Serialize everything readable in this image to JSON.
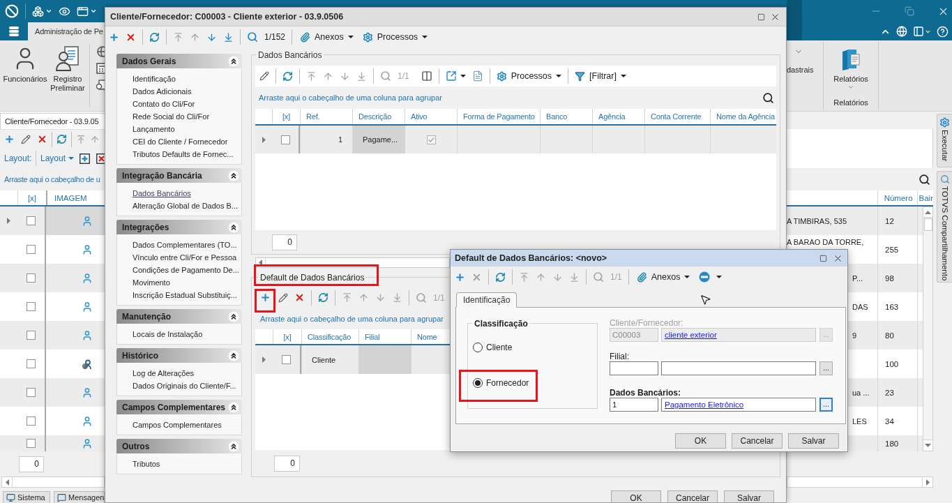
{
  "app": {
    "ribbon_tab": "Administração de Pe",
    "ribbon_buttons": [
      "Funcionários",
      "Registro Preliminar"
    ],
    "ribbon_cut_label": "dastrais",
    "reports_button": "Relatórios",
    "reports_group": "Relatórios",
    "list_window": {
      "title": "Cliente/Fornecedor - 03.9.05",
      "layout_label": "Layout:",
      "layout_menu": "Layout",
      "group_hint": "Arraste aqui o cabeçalho de u",
      "columns": [
        "[x]",
        "IMAGEM"
      ],
      "right_columns": [
        "Número",
        "Bair"
      ],
      "rows": [
        {
          "selected": true,
          "checked": false,
          "marked": false,
          "column_3": "A TIMBIRAS, 535",
          "number": "12"
        },
        {
          "selected": false,
          "checked": false,
          "marked": false,
          "column_3": "A BARAO DA TORRE,",
          "number": "255"
        },
        {
          "selected": false,
          "checked": false,
          "marked": false,
          "column_3": "P...",
          "number": "98"
        },
        {
          "selected": false,
          "checked": false,
          "marked": false,
          "column_3": "DAS",
          "number": "163"
        },
        {
          "selected": false,
          "checked": false,
          "marked": false,
          "column_3": "9",
          "number": "80"
        },
        {
          "selected": false,
          "checked": false,
          "marked": true,
          "number": "100"
        },
        {
          "selected": false,
          "checked": false,
          "marked": false,
          "column_3": "ua ...",
          "number": "23"
        },
        {
          "selected": false,
          "checked": false,
          "marked": false,
          "column_3": "LES",
          "number": "34"
        },
        {
          "selected": false,
          "checked": false,
          "marked": false,
          "number": "180"
        }
      ],
      "footer_count": "0"
    },
    "side_tabs": [
      "Executar",
      "TOTVS Compartilhamento"
    ],
    "taskbar": [
      "Sistema",
      "Mensagen"
    ]
  },
  "main_dialog": {
    "title": "Cliente/Fornecedor: C00003 - Cliente exterior - 03.9.0506",
    "toolbar": {
      "counter": {
        "text": "1/152",
        "disabled": false
      },
      "attachments": "Anexos",
      "processes": "Processos"
    },
    "nav_groups": [
      {
        "title": "Dados Gerais",
        "expanded": true,
        "items": [
          {
            "label": "Identificação",
            "selected": false
          },
          {
            "label": "Dados Adicionais",
            "selected": false
          },
          {
            "label": "Contato do Cli/For",
            "selected": false
          },
          {
            "label": "Rede Social do Cli/For",
            "selected": false
          },
          {
            "label": "Lançamento",
            "selected": false
          },
          {
            "label": "CEI do Cliente / Fornecedor",
            "selected": false
          },
          {
            "label": "Tributos Defaults de Fornec...",
            "selected": false
          }
        ]
      },
      {
        "title": "Integração Bancária",
        "expanded": true,
        "items": [
          {
            "label": "Dados Bancários",
            "selected": true
          },
          {
            "label": "Alteração Global de Dados B...",
            "selected": false
          }
        ]
      },
      {
        "title": "Integrações",
        "expanded": true,
        "items": [
          {
            "label": "Dados Complementares (TO...",
            "selected": false
          },
          {
            "label": "Vínculo entre Cli/For e Pessoa",
            "selected": false
          },
          {
            "label": "Condições de Pagamento De...",
            "selected": false
          },
          {
            "label": "Movimento",
            "selected": false
          },
          {
            "label": "Inscrição Estadual Substituiç...",
            "selected": false
          }
        ]
      },
      {
        "title": "Manutenção",
        "expanded": true,
        "items": [
          {
            "label": "Locais de Instalação",
            "selected": false
          }
        ]
      },
      {
        "title": "Histórico",
        "expanded": true,
        "items": [
          {
            "label": "Log de Alterações",
            "selected": false
          },
          {
            "label": "Dados Originais do Cliente/F...",
            "selected": false
          }
        ]
      },
      {
        "title": "Campos Complementares",
        "expanded": true,
        "items": [
          {
            "label": "Campos Complementares",
            "selected": false
          }
        ]
      },
      {
        "title": "Outros",
        "expanded": true,
        "items": [
          {
            "label": "Tributos",
            "selected": false
          }
        ]
      }
    ],
    "bank_section": {
      "title": "Dados Bancários",
      "toolbar": {
        "counter": {
          "text": "1/1",
          "disabled": true
        },
        "processes": "Processos",
        "filter": "[Filtrar]"
      },
      "group_hint": "Arraste aqui o cabeçalho de uma coluna para agrupar",
      "columns": [
        "[x]",
        "Ref.",
        "Descrição",
        "Ativo",
        "Forma de Pagamento",
        "Banco",
        "Agência",
        "Conta Corrente",
        "Nome da Agência"
      ],
      "rows": [
        {
          "selected": true,
          "cells": [
            {
              "kind": "check",
              "checked": false,
              "disabled": false,
              "focused": false
            },
            {
              "kind": "text",
              "text": "1",
              "focused": false
            },
            {
              "kind": "text",
              "text": "Pagame...",
              "focused": true
            },
            {
              "kind": "check",
              "checked": true,
              "disabled": true,
              "focused": false
            },
            {
              "kind": "text",
              "focused": false
            },
            {
              "kind": "text",
              "focused": false
            },
            {
              "kind": "text",
              "focused": false
            },
            {
              "kind": "text",
              "focused": false
            },
            {
              "kind": "text",
              "focused": false
            }
          ]
        }
      ],
      "footer_count": "0"
    },
    "default_section": {
      "title": "Default de Dados Bancários",
      "highlighted": true,
      "toolbar": {
        "add_highlighted": true,
        "counter": {
          "text": "1/1",
          "disabled": true
        }
      },
      "group_hint": "Arraste aqui o cabeçalho de uma coluna para agrupar",
      "columns": [
        "[x]",
        "Classificação",
        "Filial",
        "Nome"
      ],
      "rows": [
        {
          "selected": true,
          "cells": [
            {
              "kind": "check",
              "checked": false,
              "disabled": false,
              "focused": false
            },
            {
              "kind": "text",
              "text": "Cliente",
              "focused": false
            },
            {
              "kind": "text",
              "focused": true
            },
            {
              "kind": "text",
              "focused": false
            }
          ]
        }
      ],
      "footer_count": "0"
    },
    "buttons": [
      "OK",
      "Cancelar",
      "Salvar"
    ]
  },
  "detail_dialog": {
    "title": "Default de Dados Bancários: <novo>",
    "toolbar": {
      "counter": {
        "text": "1/1",
        "disabled": true
      },
      "attachments": "Anexos"
    },
    "tabs": [
      {
        "label": "Identificação",
        "selected": true
      }
    ],
    "classification": {
      "title": "Classificação",
      "options": [
        {
          "label": "Cliente",
          "selected": false,
          "highlighted": false
        },
        {
          "label": "Fornecedor",
          "selected": true,
          "highlighted": true
        }
      ]
    },
    "fields": [
      {
        "label": "Cliente/Fornecedor:",
        "bold": false,
        "disabled": true,
        "focused": false,
        "code": "C00003",
        "link": "cliente exterior",
        "button": "..."
      },
      {
        "label": "Filial:",
        "bold": false,
        "disabled": false,
        "focused": false,
        "button": "..."
      },
      {
        "label": "Dados Bancários:",
        "bold": true,
        "disabled": false,
        "focused": true,
        "code": "1",
        "link": "Pagamento Eletrônico",
        "button": "..."
      }
    ],
    "buttons": [
      "OK",
      "Cancelar",
      "Salvar"
    ]
  }
}
